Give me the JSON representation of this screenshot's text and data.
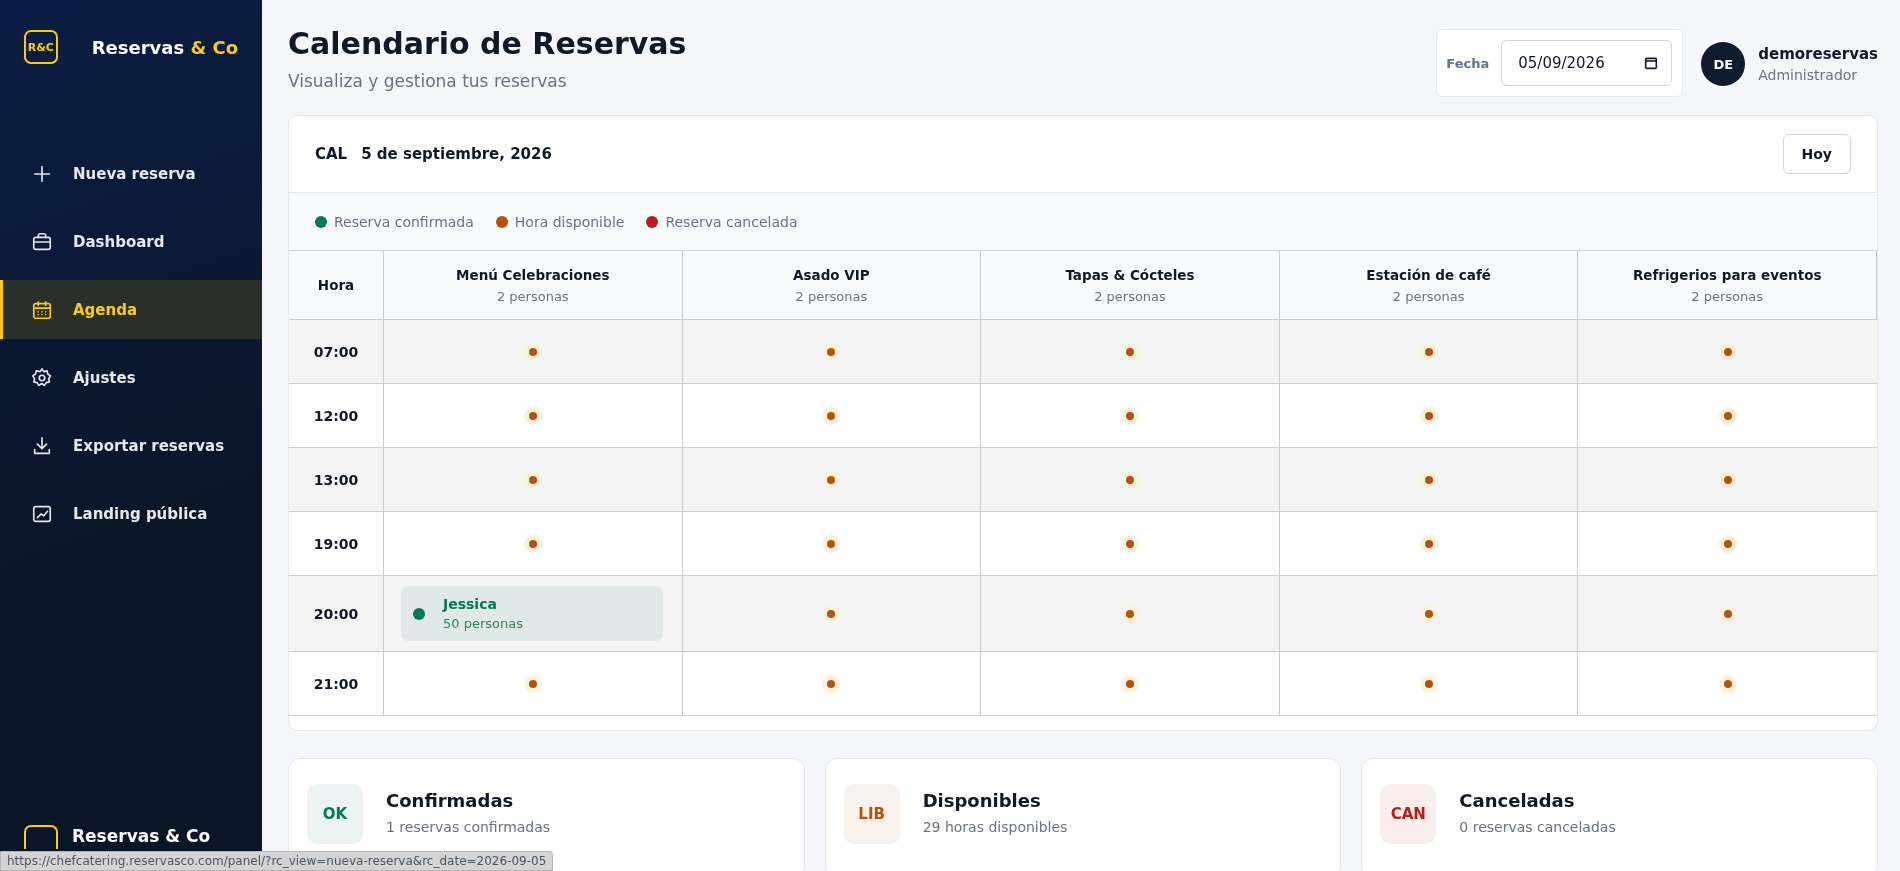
{
  "sidebar": {
    "logo": "R&C",
    "brand": "Reservas ",
    "brand_accent": "& Co",
    "items": [
      {
        "label": "Nueva reserva",
        "selected": false
      },
      {
        "label": "Dashboard",
        "selected": false
      },
      {
        "label": "Agenda",
        "selected": true
      },
      {
        "label": "Ajustes",
        "selected": false
      },
      {
        "label": "Exportar reservas",
        "selected": false
      },
      {
        "label": "Landing pública",
        "selected": false
      }
    ],
    "footer_brand": "Reservas & Co"
  },
  "header": {
    "title": "Calendario de Reservas",
    "subtitle": "Visualiza y gestiona tus reservas",
    "date_label": "Fecha",
    "date_value": "05/09/2026",
    "user": {
      "initials": "DE",
      "name": "demoreservas",
      "role": "Administrador"
    }
  },
  "calendar": {
    "badge": "CAL",
    "date": "5 de septiembre, 2026",
    "today_button": "Hoy",
    "legend": [
      {
        "label": "Reserva confirmada",
        "color": "#047857"
      },
      {
        "label": "Hora disponible",
        "color": "#b45309"
      },
      {
        "label": "Reserva cancelada",
        "color": "#b91c1c"
      }
    ],
    "hour_header": "Hora",
    "columns": [
      {
        "name": "Menú Celebraciones",
        "capacity": "2 personas"
      },
      {
        "name": "Asado VIP",
        "capacity": "2 personas"
      },
      {
        "name": "Tapas & Cócteles",
        "capacity": "2 personas"
      },
      {
        "name": "Estación de café",
        "capacity": "2 personas"
      },
      {
        "name": "Refrigerios para eventos",
        "capacity": "2 personas"
      }
    ],
    "rows": [
      {
        "time": "07:00",
        "cells": [
          {
            "kind": "available"
          },
          {
            "kind": "available"
          },
          {
            "kind": "available"
          },
          {
            "kind": "available"
          },
          {
            "kind": "available"
          }
        ]
      },
      {
        "time": "12:00",
        "cells": [
          {
            "kind": "available"
          },
          {
            "kind": "available"
          },
          {
            "kind": "available"
          },
          {
            "kind": "available"
          },
          {
            "kind": "available"
          }
        ]
      },
      {
        "time": "13:00",
        "cells": [
          {
            "kind": "available"
          },
          {
            "kind": "available"
          },
          {
            "kind": "available"
          },
          {
            "kind": "available"
          },
          {
            "kind": "available"
          }
        ]
      },
      {
        "time": "19:00",
        "cells": [
          {
            "kind": "available"
          },
          {
            "kind": "available"
          },
          {
            "kind": "available"
          },
          {
            "kind": "available"
          },
          {
            "kind": "available"
          }
        ]
      },
      {
        "time": "20:00",
        "cells": [
          {
            "kind": "booking",
            "name": "Jessica",
            "people": "50 personas",
            "color": "#047857"
          },
          {
            "kind": "available"
          },
          {
            "kind": "available"
          },
          {
            "kind": "available"
          },
          {
            "kind": "available"
          }
        ]
      },
      {
        "time": "21:00",
        "cells": [
          {
            "kind": "available"
          },
          {
            "kind": "available"
          },
          {
            "kind": "available"
          },
          {
            "kind": "available"
          },
          {
            "kind": "available"
          }
        ]
      }
    ]
  },
  "summary": [
    {
      "badge": "OK",
      "title": "Confirmadas",
      "text": "1 reservas confirmadas",
      "color": "#047857"
    },
    {
      "badge": "LIB",
      "title": "Disponibles",
      "text": "29 horas disponibles",
      "color": "#b45309"
    },
    {
      "badge": "CAN",
      "title": "Canceladas",
      "text": "0 reservas canceladas",
      "color": "#b91c1c"
    }
  ],
  "status_bar": {
    "url": "https://chefcatering.reservasco.com/panel/?rc_view=nueva-reserva&rc_date=2026-09-05"
  }
}
